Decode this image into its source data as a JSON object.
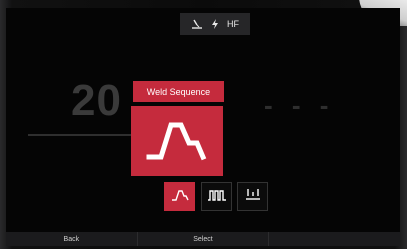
{
  "status_bar": {
    "process_icon": "stick-electrode-icon",
    "ignition_icon": "lightning-icon",
    "ignition_label": "HF"
  },
  "background": {
    "left_readout": "20",
    "right_readout": "- - -"
  },
  "popup": {
    "title": "Weld Sequence",
    "selected_icon": "trapezoid-sequence-icon"
  },
  "options": [
    {
      "icon": "trapezoid-sequence-icon",
      "selected": true
    },
    {
      "icon": "pulse-sequence-icon",
      "selected": false
    },
    {
      "icon": "spot-sequence-icon",
      "selected": false
    }
  ],
  "softkeys": {
    "back": "Back",
    "select": "Select",
    "third": ""
  },
  "colors": {
    "accent": "#c52b3d",
    "screen_bg": "#050505",
    "text": "#ffffff"
  }
}
